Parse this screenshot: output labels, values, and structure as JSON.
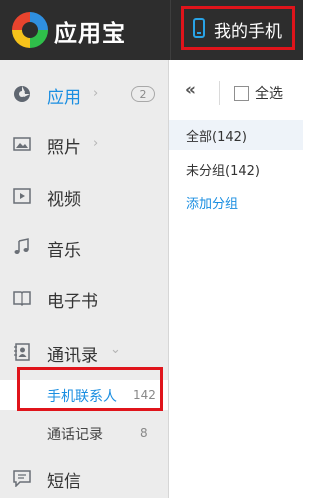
{
  "header": {
    "app_name": "应用宝",
    "device_tab": "我的手机"
  },
  "sidebar": {
    "items": [
      {
        "label": "应用",
        "badge": "2",
        "icon": "apps-icon"
      },
      {
        "label": "照片",
        "icon": "photo-icon"
      },
      {
        "label": "视频",
        "icon": "video-icon"
      },
      {
        "label": "音乐",
        "icon": "music-icon"
      },
      {
        "label": "电子书",
        "icon": "book-icon"
      },
      {
        "label": "通讯录",
        "icon": "contacts-icon"
      },
      {
        "label": "短信",
        "icon": "sms-icon"
      }
    ],
    "contacts_sub": [
      {
        "label": "手机联系人",
        "count": "142"
      },
      {
        "label": "通话记录",
        "count": "8"
      }
    ]
  },
  "toolbar": {
    "collapse_glyph": "«",
    "select_all": "全选"
  },
  "groups": [
    {
      "label": "全部(142)"
    },
    {
      "label": "未分组(142)"
    },
    {
      "label": "添加分组"
    }
  ],
  "colors": {
    "accent": "#1a8ee1",
    "highlight": "#e0141b",
    "header_bg": "#2d2d2d",
    "sidebar_bg": "#ececec"
  }
}
